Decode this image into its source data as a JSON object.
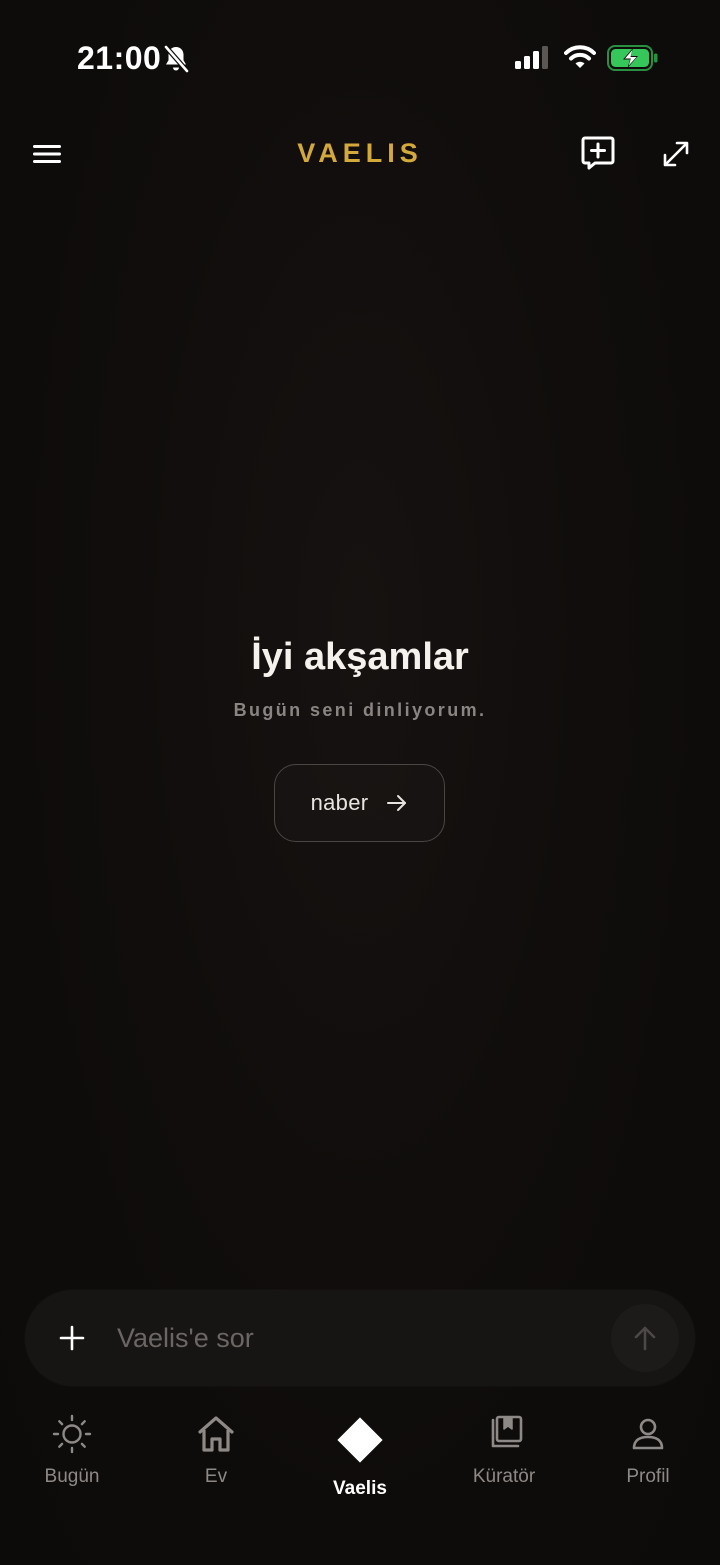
{
  "status_bar": {
    "time": "21:00"
  },
  "header": {
    "brand": "VAELIS"
  },
  "main": {
    "greeting": "İyi akşamlar",
    "subtitle": "Bugün seni dinliyorum.",
    "suggestion": "naber"
  },
  "composer": {
    "placeholder": "Vaelis'e sor"
  },
  "nav": {
    "items": [
      {
        "label": "Bugün",
        "icon": "sun-icon"
      },
      {
        "label": "Ev",
        "icon": "home-icon"
      },
      {
        "label": "Vaelis",
        "icon": "diamond-icon",
        "active": true
      },
      {
        "label": "Küratör",
        "icon": "bookmark-library-icon"
      },
      {
        "label": "Profil",
        "icon": "user-icon"
      }
    ]
  },
  "colors": {
    "brand": "#d4a93c",
    "background": "#0e0c0b",
    "battery_green": "#35c759"
  }
}
